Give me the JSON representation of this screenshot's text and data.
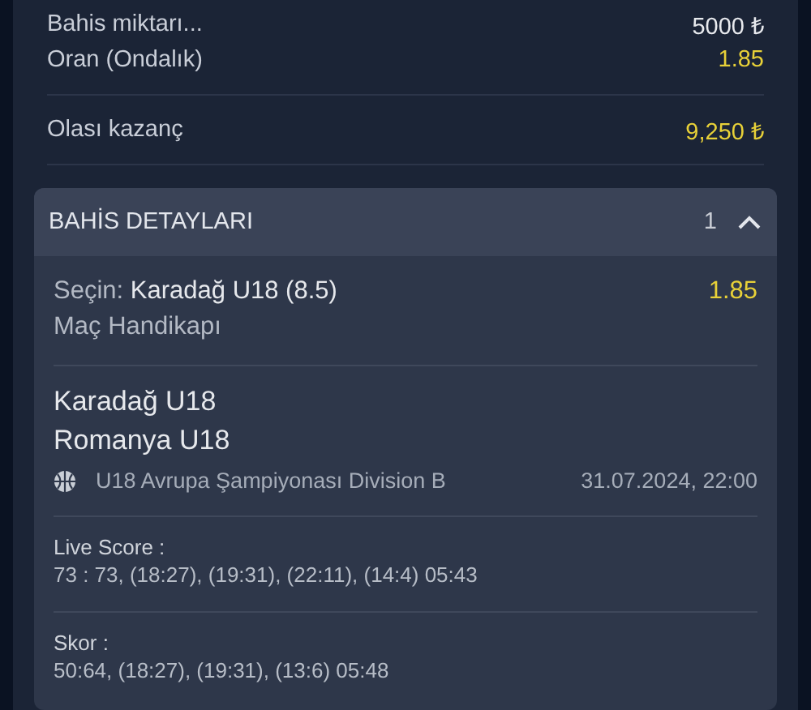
{
  "summary": [
    {
      "label": "Bahis miktarı...",
      "value": "5000 ₺",
      "kind": "plain"
    },
    {
      "label": "Oran (Ondalık)",
      "value": "1.85",
      "kind": "highlight"
    },
    {
      "label": "Olası kazanç",
      "value": "9,250 ₺",
      "kind": "highlight"
    }
  ],
  "details": {
    "title": "BAHİS DETAYLARI",
    "count": "1",
    "expanded": true,
    "selection": {
      "prefix": "Seçin:",
      "pick": "Karadağ U18 (8.5)",
      "market": "Maç Handikapı",
      "odds": "1.85"
    },
    "teams": [
      "Karadağ U18",
      "Romanya U18"
    ],
    "league": "U18 Avrupa Şampiyonası Division B",
    "datetime": "31.07.2024, 22:00",
    "scores": [
      {
        "label": "Live Score :",
        "value": "73 : 73, (18:27), (19:31), (22:11), (14:4) 05:43"
      },
      {
        "label": "Skor :",
        "value": "50:64, (18:27), (19:31), (13:6) 05:48"
      }
    ]
  }
}
